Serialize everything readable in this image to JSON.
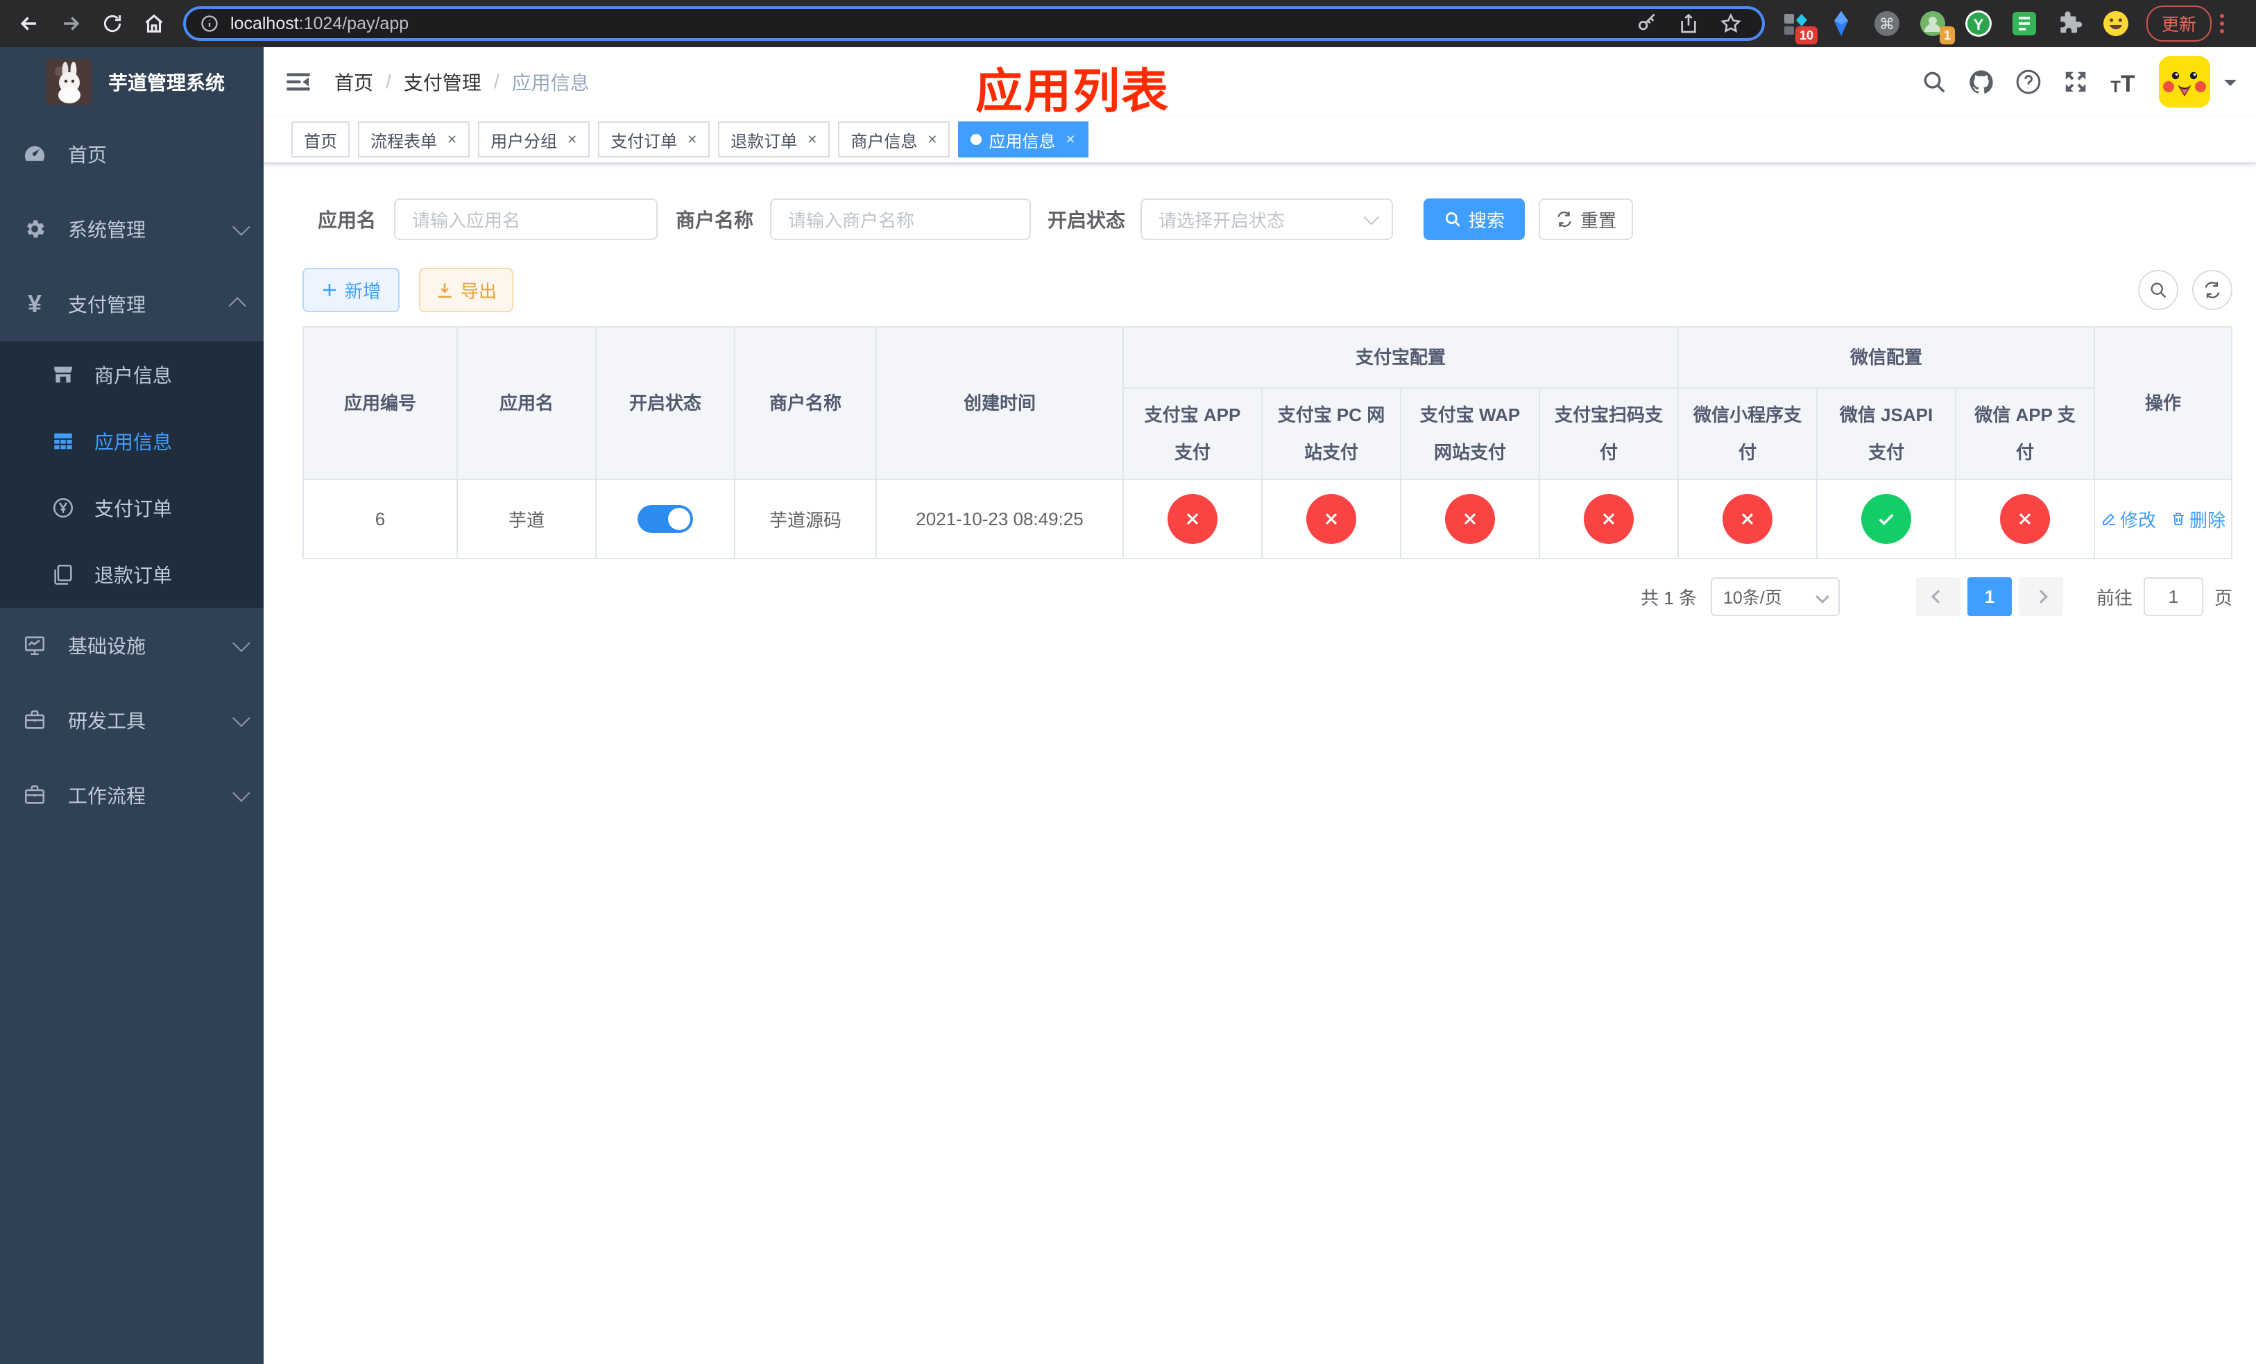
{
  "browser": {
    "url_host": "localhost",
    "url_rest": ":1024/pay/app",
    "update_label": "更新",
    "ext_badge_1": "10",
    "ext_badge_2": "1"
  },
  "sidebar": {
    "title": "芋道管理系统",
    "menu": [
      {
        "label": "首页",
        "icon": "dashboard-icon"
      },
      {
        "label": "系统管理",
        "icon": "gear-icon",
        "arrow": "down"
      },
      {
        "label": "支付管理",
        "icon": "yen-icon",
        "arrow": "up",
        "children": [
          {
            "label": "商户信息",
            "icon": "shop-icon"
          },
          {
            "label": "应用信息",
            "icon": "grid-icon",
            "active": true
          },
          {
            "label": "支付订单",
            "icon": "yen-circle-icon"
          },
          {
            "label": "退款订单",
            "icon": "documents-icon"
          }
        ]
      },
      {
        "label": "基础设施",
        "icon": "monitor-icon",
        "arrow": "down"
      },
      {
        "label": "研发工具",
        "icon": "briefcase-icon",
        "arrow": "down"
      },
      {
        "label": "工作流程",
        "icon": "briefcase-icon",
        "arrow": "down"
      }
    ]
  },
  "header": {
    "breadcrumb": [
      "首页",
      "支付管理",
      "应用信息"
    ],
    "overlay_title": "应用列表"
  },
  "tabs": [
    {
      "label": "首页",
      "closable": false,
      "active": false
    },
    {
      "label": "流程表单",
      "closable": true,
      "active": false
    },
    {
      "label": "用户分组",
      "closable": true,
      "active": false
    },
    {
      "label": "支付订单",
      "closable": true,
      "active": false
    },
    {
      "label": "退款订单",
      "closable": true,
      "active": false
    },
    {
      "label": "商户信息",
      "closable": true,
      "active": false
    },
    {
      "label": "应用信息",
      "closable": true,
      "active": true
    }
  ],
  "filter": {
    "app_name_label": "应用名",
    "app_name_placeholder": "请输入应用名",
    "merchant_label": "商户名称",
    "merchant_placeholder": "请输入商户名称",
    "status_label": "开启状态",
    "status_placeholder": "请选择开启状态",
    "search_label": "搜索",
    "reset_label": "重置"
  },
  "toolbar": {
    "add_label": "新增",
    "export_label": "导出"
  },
  "table": {
    "columns_left": [
      "应用编号",
      "应用名",
      "开启状态",
      "商户名称",
      "创建时间"
    ],
    "groups": [
      {
        "label": "支付宝配置",
        "span": 4
      },
      {
        "label": "微信配置",
        "span": 3
      }
    ],
    "sub_columns": [
      [
        "支付宝 APP",
        "支付"
      ],
      [
        "支付宝 PC 网",
        "站支付"
      ],
      [
        "支付宝 WAP",
        "网站支付"
      ],
      [
        "支付宝扫码支",
        "付"
      ],
      [
        "微信小程序支",
        "付"
      ],
      [
        "微信 JSAPI",
        "支付"
      ],
      [
        "微信 APP 支",
        "付"
      ]
    ],
    "ops_label": "操作",
    "rows": [
      {
        "id": "6",
        "name": "芋道",
        "enabled": true,
        "merchant": "芋道源码",
        "created": "2021-10-23 08:49:25",
        "statuses": [
          false,
          false,
          false,
          false,
          false,
          true,
          false
        ],
        "ops": [
          "修改",
          "删除"
        ]
      }
    ]
  },
  "pagination": {
    "total": "共 1 条",
    "page_size": "10条/页",
    "page": "1",
    "goto_label": "前往",
    "goto_value": "1",
    "page_suffix": "页"
  },
  "colors": {
    "accent": "#409EFF",
    "success": "#13ce66",
    "danger": "#fa4343",
    "title_red": "#ff2b00"
  }
}
